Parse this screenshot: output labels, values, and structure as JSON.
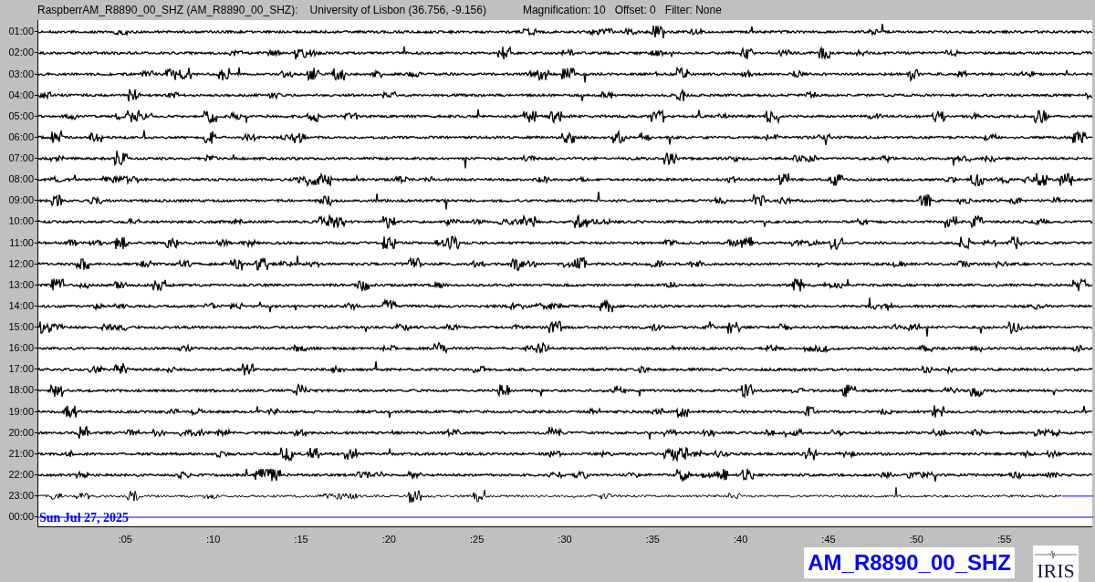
{
  "header": {
    "station": "RaspberrAM_R8890_00_SHZ (AM_R8890_00_SHZ):",
    "location": "University of Lisbon (36.756, -9.156)",
    "magnification": "Magnification: 10",
    "offset": "Offset: 0",
    "filter": "Filter: None"
  },
  "rows": [
    {
      "time": "01:00",
      "kind": "full"
    },
    {
      "time": "02:00",
      "kind": "full"
    },
    {
      "time": "03:00",
      "kind": "full"
    },
    {
      "time": "04:00",
      "kind": "full"
    },
    {
      "time": "05:00",
      "kind": "full"
    },
    {
      "time": "06:00",
      "kind": "full"
    },
    {
      "time": "07:00",
      "kind": "full"
    },
    {
      "time": "08:00",
      "kind": "full"
    },
    {
      "time": "09:00",
      "kind": "full"
    },
    {
      "time": "10:00",
      "kind": "full"
    },
    {
      "time": "11:00",
      "kind": "full"
    },
    {
      "time": "12:00",
      "kind": "full"
    },
    {
      "time": "13:00",
      "kind": "full"
    },
    {
      "time": "14:00",
      "kind": "full"
    },
    {
      "time": "15:00",
      "kind": "full"
    },
    {
      "time": "16:00",
      "kind": "full"
    },
    {
      "time": "17:00",
      "kind": "full"
    },
    {
      "time": "18:00",
      "kind": "full"
    },
    {
      "time": "19:00",
      "kind": "full"
    },
    {
      "time": "20:00",
      "kind": "full"
    },
    {
      "time": "21:00",
      "kind": "full"
    },
    {
      "time": "22:00",
      "kind": "full"
    },
    {
      "time": "23:00",
      "kind": "partial"
    },
    {
      "time": "00:00",
      "kind": "empty"
    }
  ],
  "date": "Sun Jul 27, 2025",
  "x_ticks": [
    ":05",
    ":10",
    ":15",
    ":20",
    ":25",
    ":30",
    ":35",
    ":40",
    ":45",
    ":50",
    ":55"
  ],
  "station_label": "AM_R8890_00_SHZ",
  "logo_text": "IRIS"
}
